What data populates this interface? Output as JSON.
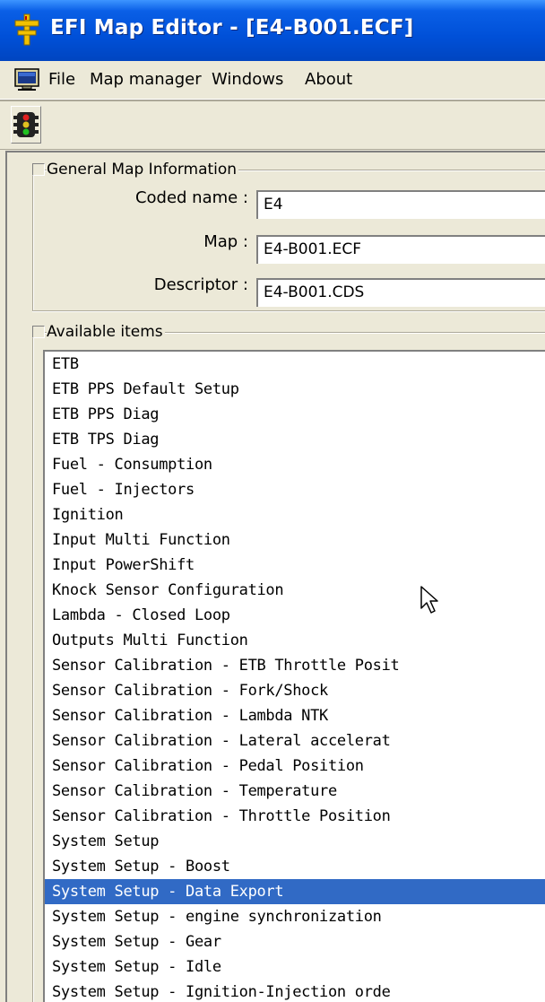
{
  "window": {
    "title": "EFI Map Editor - [E4-B001.ECF]"
  },
  "menu": {
    "items": [
      "File",
      "Map manager",
      "Windows",
      "About"
    ]
  },
  "toolbar": {
    "icon": "traffic-light-icon"
  },
  "general_info": {
    "title": "General Map Information",
    "coded_name_label": "Coded name :",
    "coded_name_value": "E4",
    "map_label": "Map :",
    "map_value": "E4-B001.ECF",
    "descriptor_label": "Descriptor :",
    "descriptor_value": "E4-B001.CDS"
  },
  "available_items": {
    "title": "Available items",
    "selected_index": 21,
    "items": [
      "ETB",
      "ETB PPS Default Setup",
      "ETB PPS Diag",
      "ETB TPS Diag",
      "Fuel - Consumption",
      "Fuel - Injectors",
      "Ignition",
      "Input Multi Function",
      "Input PowerShift",
      "Knock Sensor Configuration",
      "Lambda - Closed Loop",
      "Outputs Multi Function",
      "Sensor Calibration - ETB Throttle Posit",
      "Sensor Calibration - Fork/Shock",
      "Sensor Calibration - Lambda NTK",
      "Sensor Calibration - Lateral accelerat",
      "Sensor Calibration - Pedal Position",
      "Sensor Calibration - Temperature",
      "Sensor Calibration - Throttle Position",
      "System Setup",
      "System Setup - Boost",
      "System Setup - Data Export",
      "System Setup - engine synchronization",
      "System Setup - Gear",
      "System Setup - Idle",
      "System Setup - Ignition-Injection orde"
    ]
  },
  "colors": {
    "titlebar": "#0050d8",
    "selection": "#316ac5",
    "face": "#ece9d8"
  }
}
